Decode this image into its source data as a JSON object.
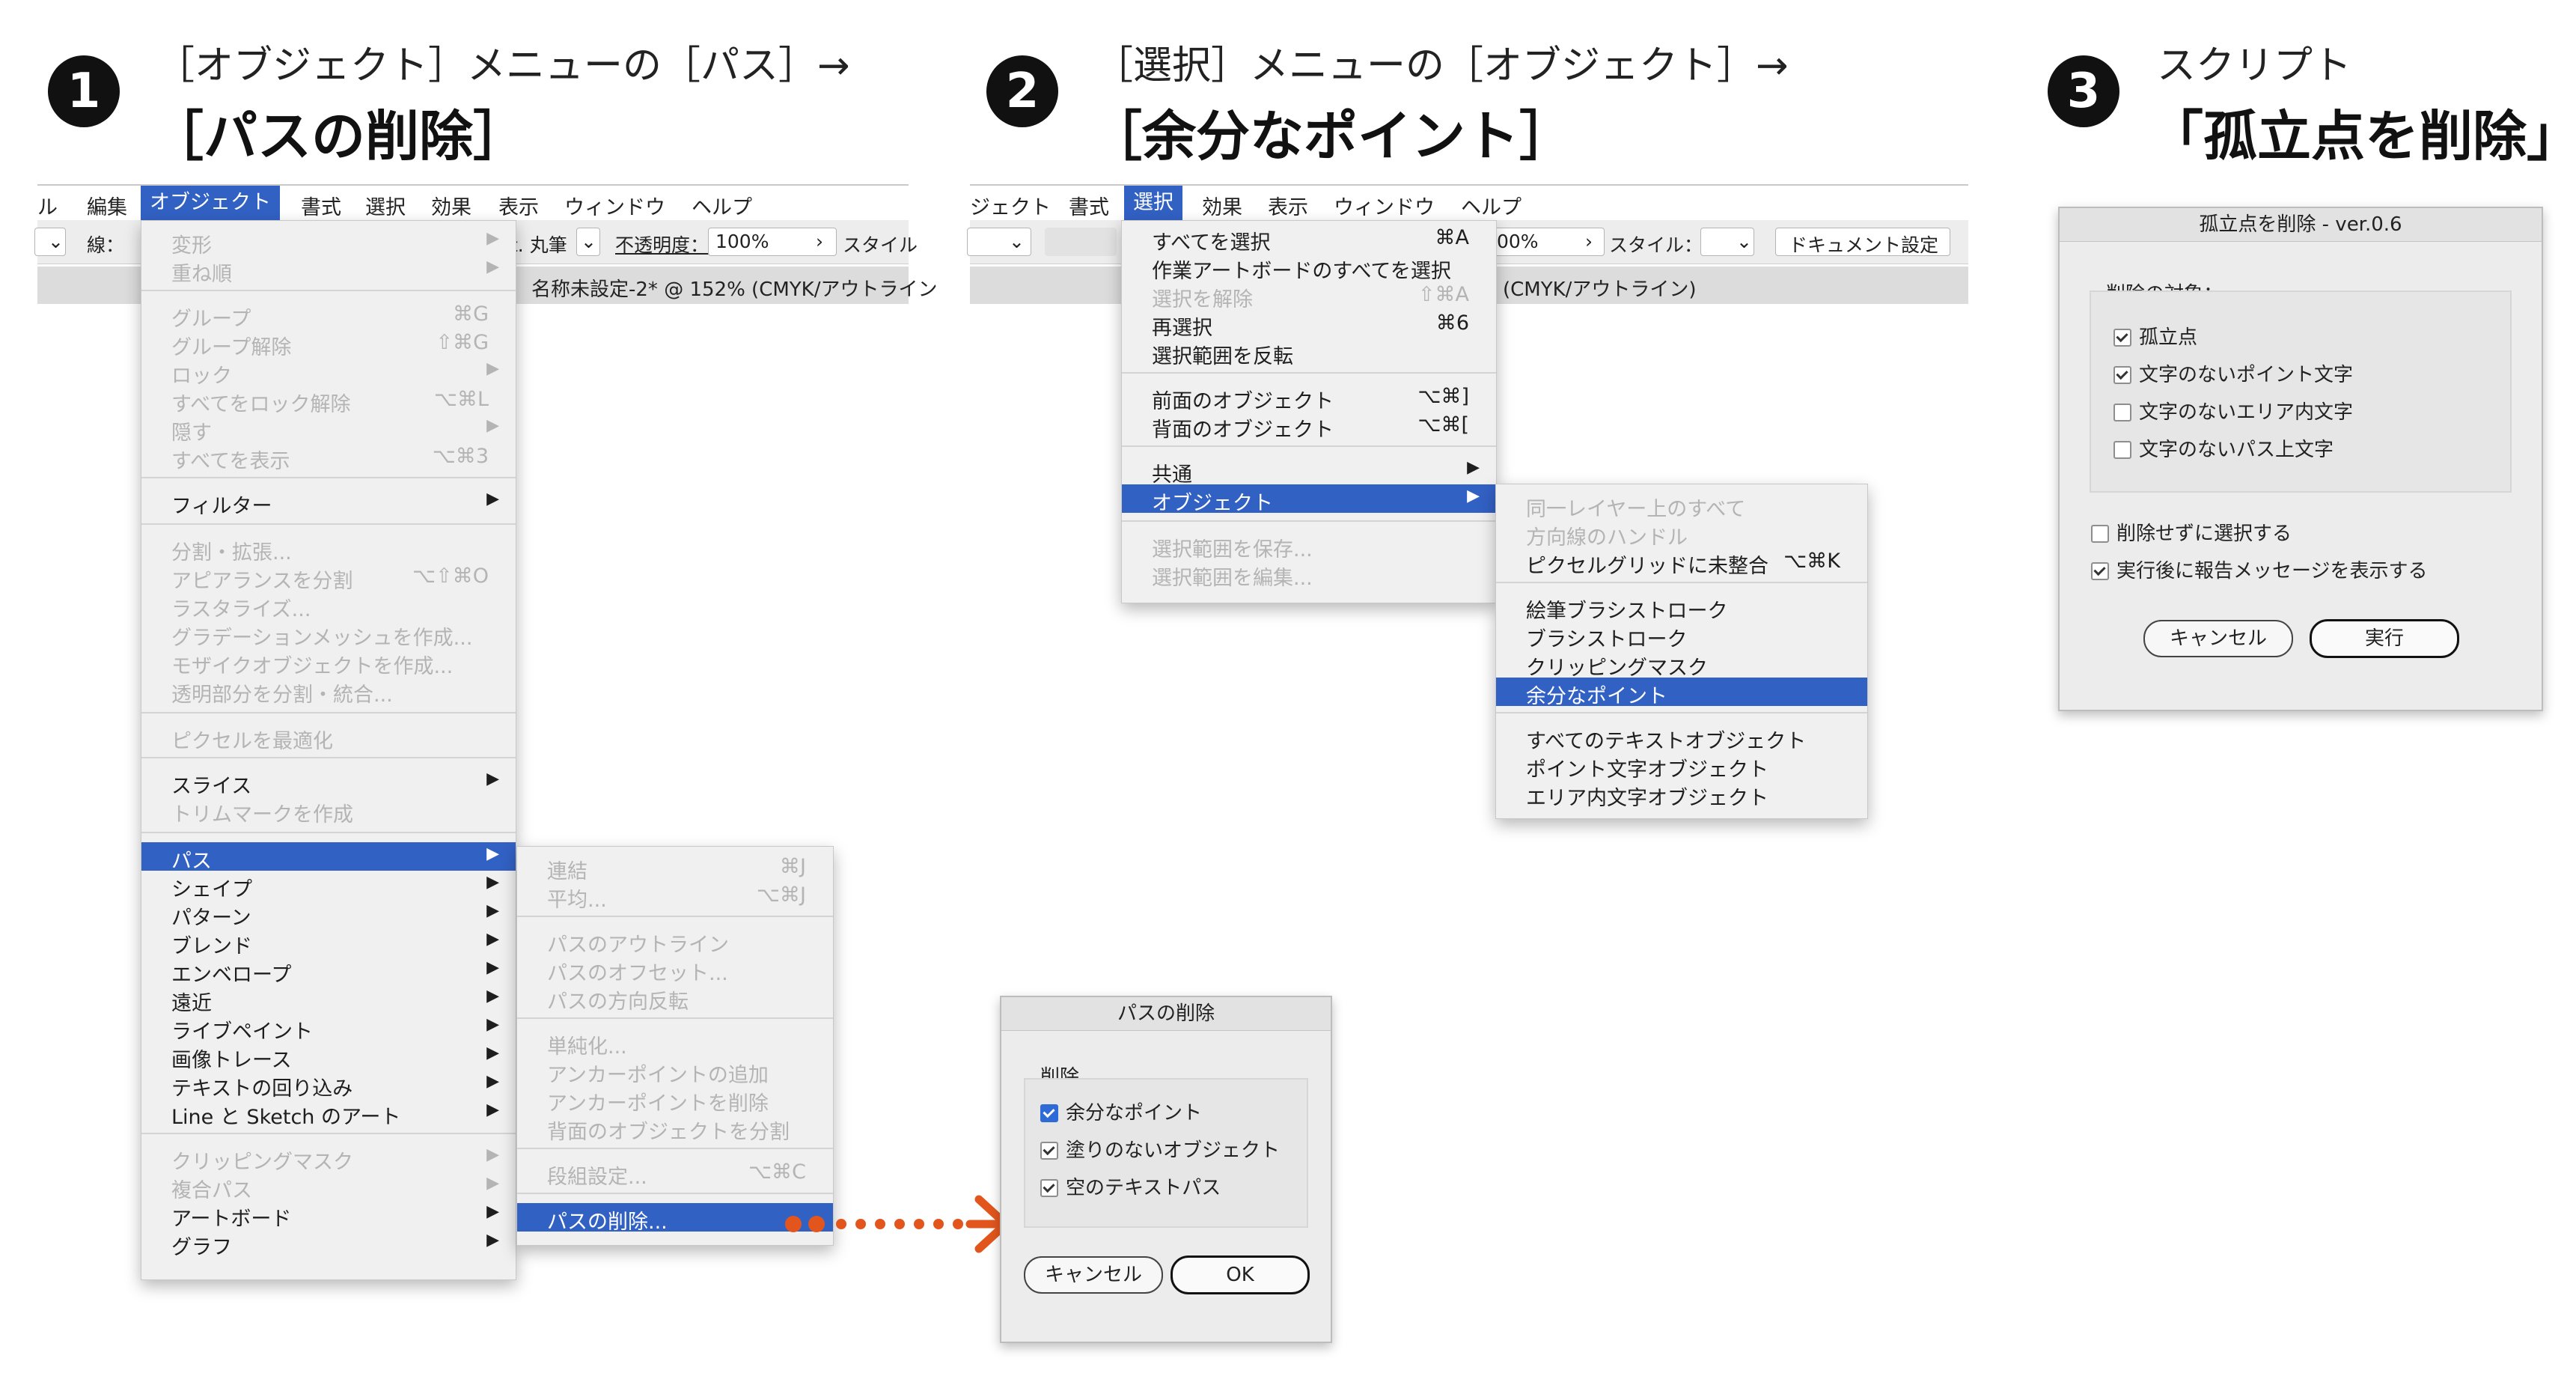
{
  "steps": [
    {
      "number": "1",
      "subtitle": "［オブジェクト］メニューの［パス］→",
      "title": "［パスの削除］"
    },
    {
      "number": "2",
      "subtitle": "［選択］メニューの［オブジェクト］→",
      "title": "［余分なポイント］"
    },
    {
      "number": "3",
      "subtitle": "スクリプト",
      "title": "「孤立点を削除」"
    }
  ],
  "panel1": {
    "menubar": [
      "ル",
      "編集",
      "オブジェクト",
      "書式",
      "選択",
      "効果",
      "表示",
      "ウィンドウ",
      "ヘルプ"
    ],
    "toolbar": {
      "stroke_label": "線：",
      "brush": "t. 丸筆",
      "opacity_label": "不透明度：",
      "opacity_value": "100%",
      "style_label": "スタイル"
    },
    "doc_tab": "名称未設定-2* @ 152% (CMYK/アウトライン",
    "menu": {
      "group1": [
        {
          "label": "変形",
          "shortcut": "▶"
        },
        {
          "label": "重ね順",
          "shortcut": "▶"
        }
      ],
      "group2": [
        {
          "label": "グループ",
          "shortcut": "⌘G"
        },
        {
          "label": "グループ解除",
          "shortcut": "⇧⌘G"
        },
        {
          "label": "ロック",
          "shortcut": "▶"
        },
        {
          "label": "すべてをロック解除",
          "shortcut": "⌥⌘L"
        },
        {
          "label": "隠す",
          "shortcut": "▶"
        },
        {
          "label": "すべてを表示",
          "shortcut": "⌥⌘3"
        }
      ],
      "filter": {
        "label": "フィルター",
        "shortcut": "▶"
      },
      "group3": [
        {
          "label": "分割・拡張..."
        },
        {
          "label": "アピアランスを分割",
          "shortcut": "⌥⇧⌘O"
        },
        {
          "label": "ラスタライズ..."
        },
        {
          "label": "グラデーションメッシュを作成..."
        },
        {
          "label": "モザイクオブジェクトを作成..."
        },
        {
          "label": "透明部分を分割・統合..."
        }
      ],
      "pixel": {
        "label": "ピクセルを最適化"
      },
      "group4": [
        {
          "label": "スライス",
          "shortcut": "▶"
        },
        {
          "label": "トリムマークを作成"
        }
      ],
      "group5": [
        {
          "label": "パス",
          "shortcut": "▶"
        },
        {
          "label": "シェイプ",
          "shortcut": "▶"
        },
        {
          "label": "パターン",
          "shortcut": "▶"
        },
        {
          "label": "ブレンド",
          "shortcut": "▶"
        },
        {
          "label": "エンベロープ",
          "shortcut": "▶"
        },
        {
          "label": "遠近",
          "shortcut": "▶"
        },
        {
          "label": "ライブペイント",
          "shortcut": "▶"
        },
        {
          "label": "画像トレース",
          "shortcut": "▶"
        },
        {
          "label": "テキストの回り込み",
          "shortcut": "▶"
        },
        {
          "label": "Line と Sketch のアート",
          "shortcut": "▶"
        }
      ],
      "group6": [
        {
          "label": "クリッピングマスク",
          "shortcut": "▶"
        },
        {
          "label": "複合パス",
          "shortcut": "▶"
        },
        {
          "label": "アートボード",
          "shortcut": "▶"
        },
        {
          "label": "グラフ",
          "shortcut": "▶"
        }
      ]
    },
    "submenu": {
      "group1": [
        {
          "label": "連結",
          "shortcut": "⌘J"
        },
        {
          "label": "平均...",
          "shortcut": "⌥⌘J"
        }
      ],
      "group2": [
        {
          "label": "パスのアウトライン"
        },
        {
          "label": "パスのオフセット..."
        },
        {
          "label": "パスの方向反転"
        }
      ],
      "group3": [
        {
          "label": "単純化..."
        },
        {
          "label": "アンカーポイントの追加"
        },
        {
          "label": "アンカーポイントを削除"
        },
        {
          "label": "背面のオブジェクトを分割"
        }
      ],
      "group4": [
        {
          "label": "段組設定...",
          "shortcut": "⌥⌘C"
        }
      ],
      "group5": [
        {
          "label": "パスの削除..."
        }
      ]
    }
  },
  "dialog1": {
    "title": "パスの削除",
    "group_label": "削除",
    "options": [
      "余分なポイント",
      "塗りのないオブジェクト",
      "空のテキストパス"
    ],
    "cancel": "キャンセル",
    "ok": "OK"
  },
  "panel2": {
    "menubar": [
      "ジェクト",
      "書式",
      "選択",
      "効果",
      "表示",
      "ウィンドウ",
      "ヘルプ"
    ],
    "toolbar": {
      "opacity_value": "00%",
      "style_label": "スタイル：",
      "doc_settings": "ドキュメント設定"
    },
    "doc_tab": "(CMYK/アウトライン)",
    "menu": {
      "group1": [
        {
          "label": "すべてを選択",
          "shortcut": "⌘A"
        },
        {
          "label": "作業アートボードのすべてを選択"
        },
        {
          "label": "選択を解除",
          "shortcut": "⇧⌘A"
        },
        {
          "label": "再選択",
          "shortcut": "⌘6"
        },
        {
          "label": "選択範囲を反転"
        }
      ],
      "group2": [
        {
          "label": "前面のオブジェクト",
          "shortcut": "⌥⌘]"
        },
        {
          "label": "背面のオブジェクト",
          "shortcut": "⌥⌘["
        }
      ],
      "group3": [
        {
          "label": "共通",
          "shortcut": "▶"
        },
        {
          "label": "オブジェクト",
          "shortcut": "▶"
        }
      ],
      "group4": [
        {
          "label": "選択範囲を保存..."
        },
        {
          "label": "選択範囲を編集..."
        }
      ]
    },
    "submenu": {
      "group1": [
        {
          "label": "同一レイヤー上のすべて"
        },
        {
          "label": "方向線のハンドル"
        },
        {
          "label": "ピクセルグリッドに未整合",
          "shortcut": "⌥⌘K"
        }
      ],
      "group2": [
        {
          "label": "絵筆ブラシストローク"
        },
        {
          "label": "ブラシストローク"
        },
        {
          "label": "クリッピングマスク"
        },
        {
          "label": "余分なポイント"
        }
      ],
      "group3": [
        {
          "label": "すべてのテキストオブジェクト"
        },
        {
          "label": "ポイント文字オブジェクト"
        },
        {
          "label": "エリア内文字オブジェクト"
        }
      ]
    }
  },
  "dialog3": {
    "title": "孤立点を削除 - ver.0.6",
    "group_label": "削除の対象：",
    "targets": [
      {
        "label": "孤立点",
        "checked": true
      },
      {
        "label": "文字のないポイント文字",
        "checked": true
      },
      {
        "label": "文字のないエリア内文字",
        "checked": false
      },
      {
        "label": "文字のないパス上文字",
        "checked": false
      }
    ],
    "extra": [
      {
        "label": "削除せずに選択する",
        "checked": false
      },
      {
        "label": "実行後に報告メッセージを表示する",
        "checked": true
      }
    ],
    "cancel": "キャンセル",
    "run": "実行"
  },
  "colors": {
    "highlight": "#3261c4",
    "arrow": "#e2561e",
    "menu_bg": "#f0f0f0",
    "dialog_bg": "#ececec"
  }
}
